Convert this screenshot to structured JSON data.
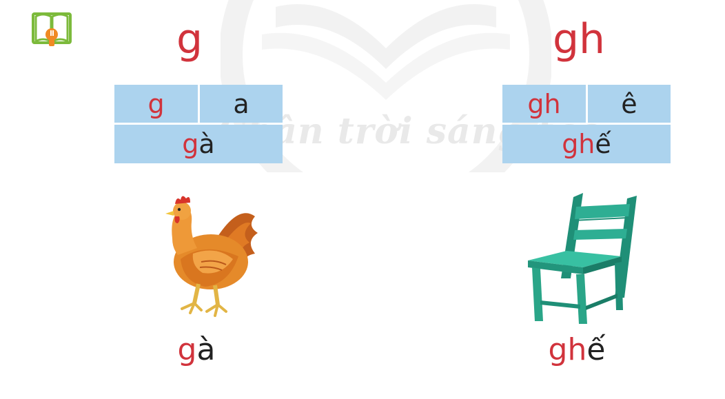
{
  "watermark": {
    "text": "Chân trời sáng tạo"
  },
  "icon": {
    "name": "book-lightbulb-icon"
  },
  "left": {
    "letter": "g",
    "cells": {
      "consonant": "g",
      "vowel": "a"
    },
    "syllable": {
      "onset": "g",
      "rime": "à"
    },
    "image": "hen",
    "word": {
      "onset": "g",
      "rime": "à"
    }
  },
  "right": {
    "letter": "gh",
    "cells": {
      "consonant": "gh",
      "vowel": "ê"
    },
    "syllable": {
      "onset": "gh",
      "rime": "ế"
    },
    "image": "chair",
    "word": {
      "onset": "gh",
      "rime": "ế"
    }
  },
  "colors": {
    "letter_red": "#d1333c",
    "cell_blue": "#acd3ee",
    "icon_green": "#7cba3b",
    "icon_orange": "#f08a24",
    "chair_teal": "#2eae93"
  }
}
